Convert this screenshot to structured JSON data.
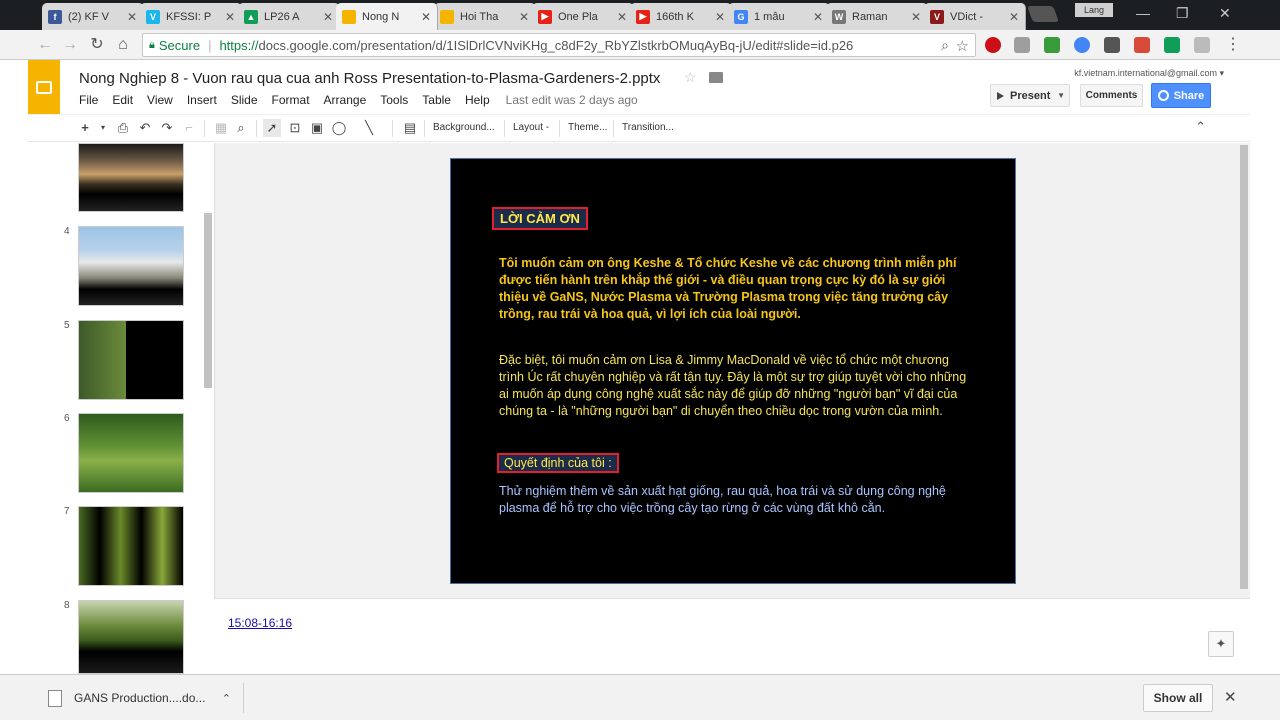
{
  "browser": {
    "tabs": [
      {
        "title": "(2) KF V",
        "favicon": "facebook-icon",
        "color": "#3b5998",
        "glyph": "f"
      },
      {
        "title": "KFSSI: P",
        "favicon": "vimeo-icon",
        "color": "#1ab7ea",
        "glyph": "V"
      },
      {
        "title": "LP26 A",
        "favicon": "drive-icon",
        "color": "#0f9d58",
        "glyph": "▲"
      },
      {
        "title": "Nong N",
        "favicon": "slides-icon",
        "color": "#f4b400",
        "glyph": "",
        "active": true
      },
      {
        "title": "Hoi Tha",
        "favicon": "slides-icon",
        "color": "#f4b400",
        "glyph": ""
      },
      {
        "title": "One Pla",
        "favicon": "youtube-icon",
        "color": "#e62117",
        "glyph": "▶"
      },
      {
        "title": "166th K",
        "favicon": "youtube-icon",
        "color": "#e62117",
        "glyph": "▶"
      },
      {
        "title": "1 mẫu",
        "favicon": "google-icon",
        "color": "#4285f4",
        "glyph": "G"
      },
      {
        "title": "Raman",
        "favicon": "wikipedia-icon",
        "color": "#777777",
        "glyph": "W"
      },
      {
        "title": "VDict -",
        "favicon": "vdict-icon",
        "color": "#8b1a1a",
        "glyph": "V"
      }
    ],
    "profile_label": "Lang",
    "url": {
      "secure_label": "Secure",
      "protocol": "https://",
      "rest": "docs.google.com/presentation/d/1ISlDrlCVNviKHg_c8dF2y_RbYZlstkrbOMuqAyBq-jU/edit#slide=id.p26"
    }
  },
  "docs": {
    "title": "Nong Nghiep 8 - Vuon rau qua cua anh Ross Presentation-to-Plasma-Gardeners-2.pptx",
    "account": "kf.vietnam.international@gmail.com ▾",
    "menu": [
      "File",
      "Edit",
      "View",
      "Insert",
      "Slide",
      "Format",
      "Arrange",
      "Tools",
      "Table",
      "Help"
    ],
    "last_edit": "Last edit was 2 days ago",
    "present_label": "Present",
    "comments_label": "Comments",
    "share_label": "Share"
  },
  "toolbar": {
    "background_label": "Background...",
    "layout_label": "Layout -",
    "theme_label": "Theme...",
    "transition_label": "Transition..."
  },
  "filmstrip": {
    "slides": [
      {
        "num": "",
        "theme": "sunset-field"
      },
      {
        "num": "4",
        "theme": "boat-yard"
      },
      {
        "num": "5",
        "theme": "garden-poster"
      },
      {
        "num": "6",
        "theme": "green-plants"
      },
      {
        "num": "7",
        "theme": "plant-collage"
      },
      {
        "num": "8",
        "theme": "garden-beds"
      }
    ]
  },
  "slide": {
    "heading": "LỜI CẢM ƠN",
    "para1": "Tôi muốn cảm ơn ông Keshe & Tổ chức Keshe về các chương trình miễn phí được tiến hành trên khắp thế giới - và điều quan trọng cực kỳ đó là sự giới thiệu về GaNS, Nước Plasma và Trường Plasma trong việc tăng trưởng cây trồng, rau trái và hoa quả, vì lợi ích của loài người.",
    "para2": "Đặc biệt, tôi muốn cảm ơn Lisa & Jimmy MacDonald về việc tổ chức một chương trình Úc rất chuyên nghiệp và rất tận tụy. Đây là một sự trợ giúp tuyệt vời cho những ai muốn áp dụng công nghệ xuất sắc này để giúp đỡ những \"người bạn\" vĩ đại của chúng ta - là \"những người bạn\" di chuyển theo chiều dọc trong vườn của mình.",
    "heading2": "Quyết định của tôi :",
    "para3": "Thử nghiệm thêm về sản xuất hạt giống, rau quả, hoa trái và sử dụng công nghệ plasma để hỗ trợ cho việc trồng cây tạo rừng ở các vùng đất khô cằn."
  },
  "notes": {
    "link": "15:08-16:16"
  },
  "downloads": {
    "file": "GANS Production....do...",
    "show_all": "Show all"
  }
}
